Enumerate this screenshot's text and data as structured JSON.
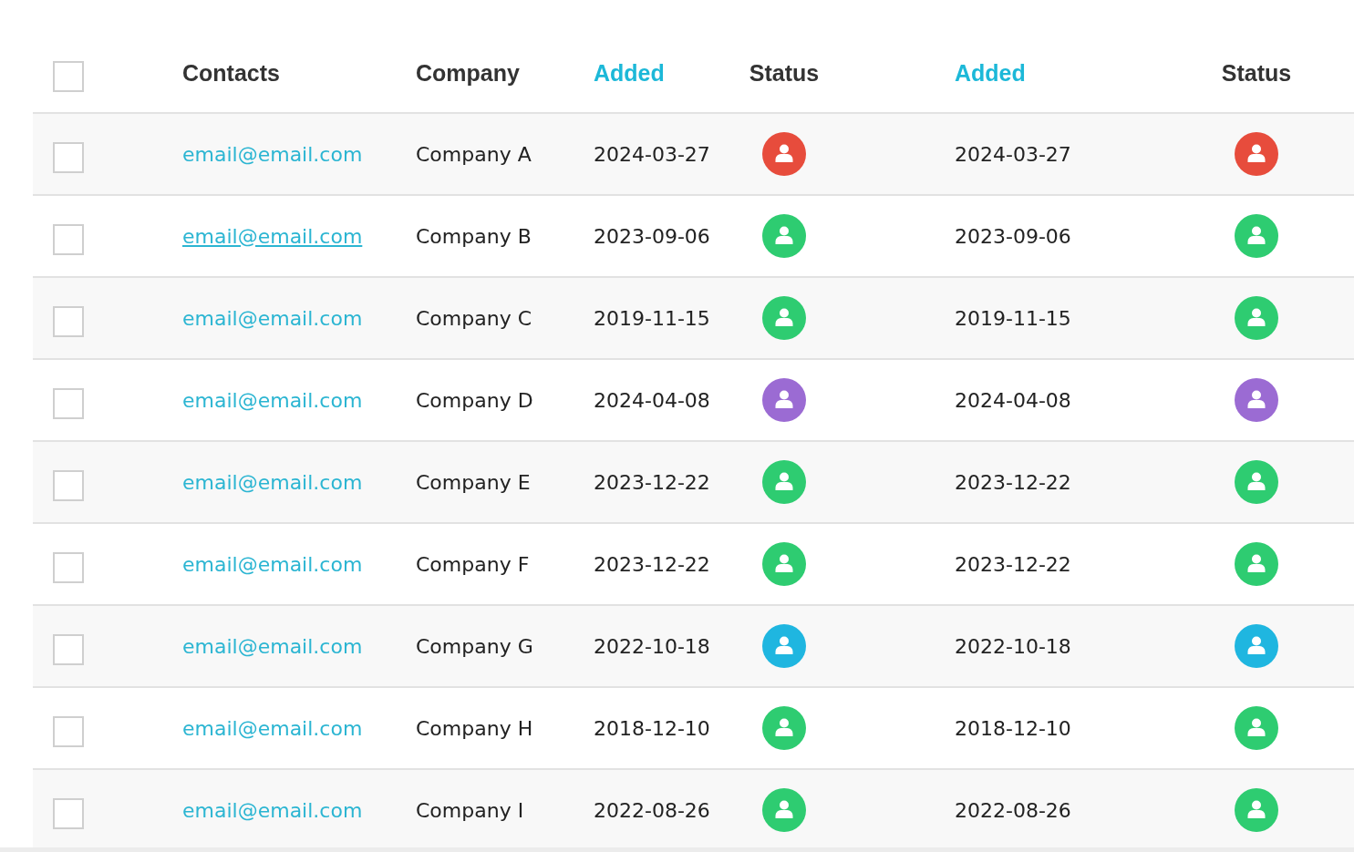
{
  "table": {
    "header_checked": false,
    "columns": [
      {
        "label": "Contacts",
        "sortable": false
      },
      {
        "label": "Company",
        "sortable": false
      },
      {
        "label": "Added",
        "sortable": true
      },
      {
        "label": "Status",
        "sortable": false
      },
      {
        "label": "Added",
        "sortable": true
      },
      {
        "label": "Status",
        "sortable": false
      }
    ],
    "rows": [
      {
        "checked": false,
        "hovered": false,
        "email": "email@email.com",
        "company": "Company A",
        "added": [
          "2024-03-27",
          "2024-03-27"
        ],
        "status": [
          {
            "color": "#e74c3c"
          },
          {
            "color": "#e74c3c"
          }
        ]
      },
      {
        "checked": false,
        "hovered": true,
        "email": "email@email.com",
        "company": "Company B",
        "added": [
          "2023-09-06",
          "2023-09-06"
        ],
        "status": [
          {
            "color": "#2ecc71"
          },
          {
            "color": "#2ecc71"
          }
        ]
      },
      {
        "checked": false,
        "hovered": false,
        "email": "email@email.com",
        "company": "Company C",
        "added": [
          "2019-11-15",
          "2019-11-15"
        ],
        "status": [
          {
            "color": "#2ecc71"
          },
          {
            "color": "#2ecc71"
          }
        ]
      },
      {
        "checked": false,
        "hovered": false,
        "email": "email@email.com",
        "company": "Company D",
        "added": [
          "2024-04-08",
          "2024-04-08"
        ],
        "status": [
          {
            "color": "#9b6bd3"
          },
          {
            "color": "#9b6bd3"
          }
        ]
      },
      {
        "checked": false,
        "hovered": false,
        "email": "email@email.com",
        "company": "Company E",
        "added": [
          "2023-12-22",
          "2023-12-22"
        ],
        "status": [
          {
            "color": "#2ecc71"
          },
          {
            "color": "#2ecc71"
          }
        ]
      },
      {
        "checked": false,
        "hovered": false,
        "email": "email@email.com",
        "company": "Company F",
        "added": [
          "2023-12-22",
          "2023-12-22"
        ],
        "status": [
          {
            "color": "#2ecc71"
          },
          {
            "color": "#2ecc71"
          }
        ]
      },
      {
        "checked": false,
        "hovered": false,
        "email": "email@email.com",
        "company": "Company G",
        "added": [
          "2022-10-18",
          "2022-10-18"
        ],
        "status": [
          {
            "color": "#1fb6e0"
          },
          {
            "color": "#1fb6e0"
          }
        ]
      },
      {
        "checked": false,
        "hovered": false,
        "email": "email@email.com",
        "company": "Company H",
        "added": [
          "2018-12-10",
          "2018-12-10"
        ],
        "status": [
          {
            "color": "#2ecc71"
          },
          {
            "color": "#2ecc71"
          }
        ]
      },
      {
        "checked": false,
        "hovered": false,
        "email": "email@email.com",
        "company": "Company I",
        "added": [
          "2022-08-26",
          "2022-08-26"
        ],
        "status": [
          {
            "color": "#2ecc71"
          },
          {
            "color": "#2ecc71"
          }
        ]
      }
    ]
  }
}
